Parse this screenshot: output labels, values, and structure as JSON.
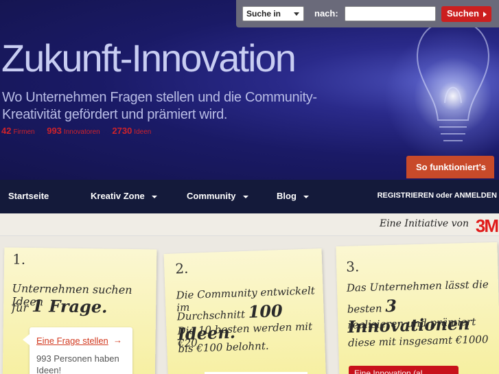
{
  "search": {
    "select_value": "Suche in",
    "label": "nach:",
    "input_value": "",
    "button_label": "Suchen"
  },
  "hero": {
    "title": "Zukunft-Innovation",
    "subtitle": "Wo Unternehmen Fragen stellen und die Community-Kreativität gefördert und prämiert wird.",
    "stats": [
      {
        "value": "42",
        "label": "Firmen"
      },
      {
        "value": "993",
        "label": "Innovatoren"
      },
      {
        "value": "2730",
        "label": "Ideen"
      }
    ],
    "how_button": "So funktioniert's"
  },
  "nav": {
    "items": [
      {
        "label": "Startseite"
      },
      {
        "label": "Kreativ Zone"
      },
      {
        "label": "Community"
      },
      {
        "label": "Blog"
      }
    ],
    "register": "REGISTRIEREN",
    "or": "oder",
    "login": "ANMELDEN"
  },
  "initiative": {
    "text": "Eine Initiative von",
    "logo": "3M"
  },
  "steps": [
    {
      "num": "1.",
      "line1": "Unternehmen suchen Ideen",
      "line2_prefix": "für",
      "line2_big": "1 Frage."
    },
    {
      "num": "2.",
      "line1": "Die Community entwickelt im",
      "line2_prefix": "Durchschnitt",
      "line2_big": "100 Ideen.",
      "line3": "Die 10 besten werden mit €20",
      "line4": "bis €100 belohnt."
    },
    {
      "num": "3.",
      "line1": "Das Unternehmen lässt die",
      "line2_prefix": "besten",
      "line2_big": "3 Innovationen",
      "line3": "realisieren und prämiert",
      "line4": "diese mit insgesamt €1000"
    }
  ],
  "bubble": {
    "link": "Eine Frage stellen",
    "text": "993 Personen haben Ideen!"
  },
  "step3_button": "Eine Innovation (al..."
}
